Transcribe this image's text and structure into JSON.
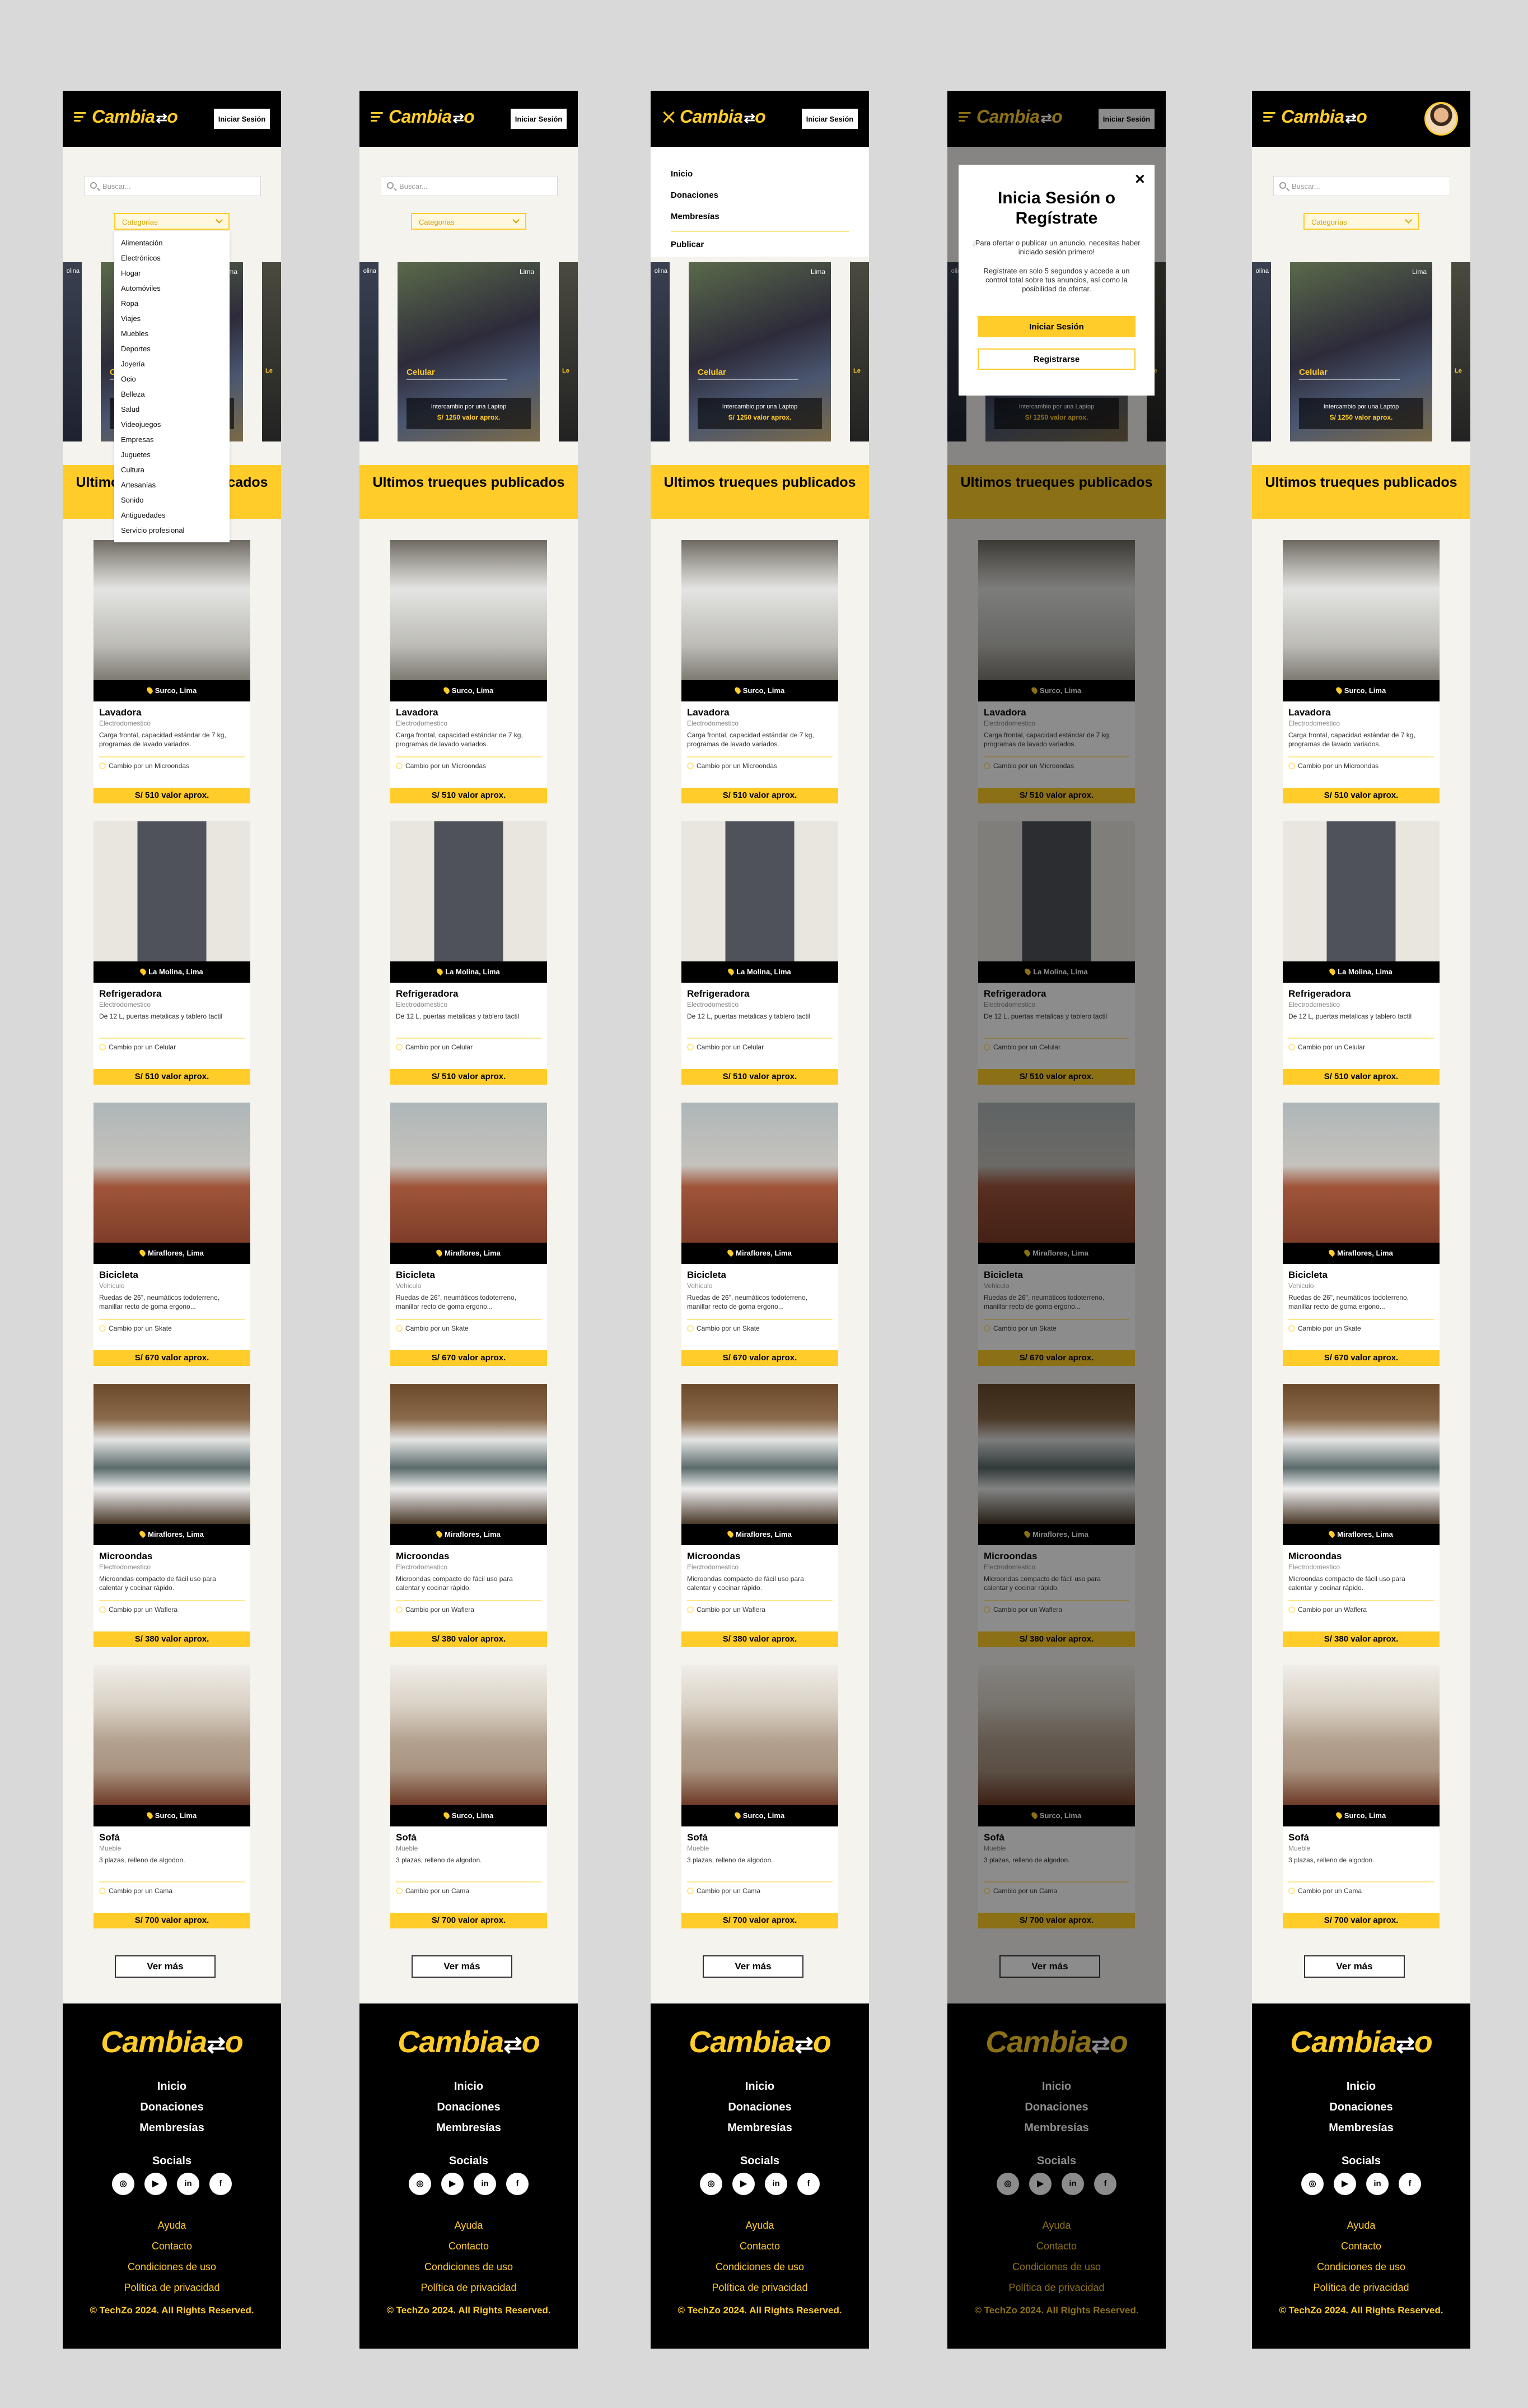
{
  "header": {
    "logo_text": "Cambia",
    "logo_swap": "⇄",
    "logo_end": "o",
    "login_label": "Iniciar Sesión"
  },
  "search": {
    "placeholder": "Buscar..."
  },
  "categories": {
    "label": "Categorías",
    "items": [
      "Alimentación",
      "Electrónicos",
      "Hogar",
      "Automóviles",
      "Ropa",
      "Viajes",
      "Muebles",
      "Deportes",
      "Joyería",
      "Ocio",
      "Belleza",
      "Salud",
      "Videojuegos",
      "Empresas",
      "Juguetes",
      "Cultura",
      "Artesanías",
      "Sonido",
      "Antiguedades",
      "Servicio profesional"
    ]
  },
  "featured": {
    "location": "Lima",
    "title": "Celular",
    "exchange": "Intercambio por una Laptop",
    "value": "S/ 1250 valor aprox.",
    "side_left": "olina",
    "side_right": "Le"
  },
  "section_title": "Ultimos trueques publicados",
  "products": [
    {
      "location": "Surco, Lima",
      "name": "Lavadora",
      "category": "Electrodomestico",
      "desc": "Carga frontal, capacidad estándar de 7 kg, programas de lavado variados.",
      "exchange": "Cambio por un Microondas",
      "price": "S/ 510 valor aprox."
    },
    {
      "location": "La Molina, Lima",
      "name": "Refrigeradora",
      "category": "Electrodomestico",
      "desc": "De 12 L, puertas metalicas y tablero tactil",
      "exchange": "Cambio por un Celular",
      "price": "S/ 510 valor aprox."
    },
    {
      "location": "Miraflores, Lima",
      "name": "Bicicleta",
      "category": "Vehiculo",
      "desc": "Ruedas de 26\", neumáticos todoterreno, manillar recto de goma ergono...",
      "exchange": "Cambio por un Skate",
      "price": "S/ 670 valor aprox."
    },
    {
      "location": "Miraflores, Lima",
      "name": "Microondas",
      "category": "Electrodomestico",
      "desc": "Microondas compacto de fácil uso para calentar y cocinar rápido.",
      "exchange": "Cambio por un Waflera",
      "price": "S/ 380 valor aprox."
    },
    {
      "location": "Surco, Lima",
      "name": "Sofá",
      "category": "Mueble",
      "desc": "3 plazas,  relleno de algodon.",
      "exchange": "Cambio por un Cama",
      "price": "S/ 700 valor aprox."
    }
  ],
  "more_label": "Ver más",
  "drawer": {
    "items": [
      "Inicio",
      "Donaciones",
      "Membresías"
    ],
    "publish": "Publicar"
  },
  "modal": {
    "title": "Inicia Sesión o Regístrate",
    "text1": "¡Para ofertar o publicar un anuncio, necesitas haber iniciado sesión primero!",
    "text2": "Regístrate en solo 5 segundos y accede a un control total sobre tus anuncios, así como la posibilidad de ofertar.",
    "login": "Iniciar Sesión",
    "register": "Registrarse",
    "close": "✕"
  },
  "footer": {
    "nav": [
      "Inicio",
      "Donaciones",
      "Membresías"
    ],
    "socials_label": "Socials",
    "icons": [
      "instagram-icon",
      "youtube-icon",
      "linkedin-icon",
      "facebook-icon"
    ],
    "links": [
      "Ayuda",
      "Contacto",
      "Condiciones de uso",
      "Política de privacidad"
    ],
    "copyright": "© TechZo 2024. All Rights Reserved."
  },
  "colors": {
    "accent": "#ffcc29",
    "dark": "#000000",
    "background": "#f5f3ee",
    "page": "#d9d9d9"
  }
}
